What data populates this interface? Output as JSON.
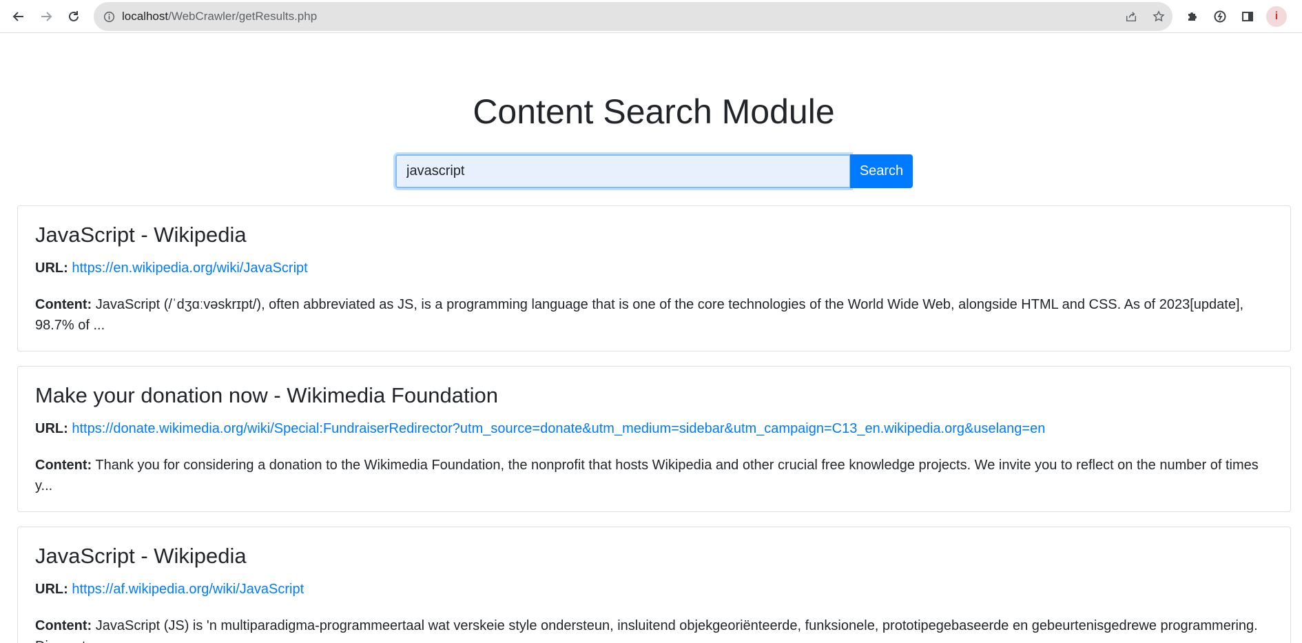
{
  "browser": {
    "url_host": "localhost",
    "url_path": "/WebCrawler/getResults.php",
    "avatar_letter": "i"
  },
  "page": {
    "title": "Content Search Module",
    "search": {
      "value": "javascript",
      "button_label": "Search"
    },
    "url_label": "URL:",
    "content_label": "Content:",
    "results": [
      {
        "title": "JavaScript - Wikipedia",
        "url": "https://en.wikipedia.org/wiki/JavaScript",
        "content": "JavaScript (/ˈdʒɑːvəskrɪpt/), often abbreviated as JS, is a programming language that is one of the core technologies of the World Wide Web, alongside HTML and CSS. As of 2023[update], 98.7% of ..."
      },
      {
        "title": "Make your donation now - Wikimedia Foundation",
        "url": "https://donate.wikimedia.org/wiki/Special:FundraiserRedirector?utm_source=donate&utm_medium=sidebar&utm_campaign=C13_en.wikipedia.org&uselang=en",
        "content": "Thank you for considering a donation to the Wikimedia Foundation, the nonprofit that hosts Wikipedia and other crucial free knowledge projects. We invite you to reflect on the number of times y..."
      },
      {
        "title": "JavaScript - Wikipedia",
        "url": "https://af.wikipedia.org/wiki/JavaScript",
        "content": "JavaScript (JS) is 'n multiparadigma-programmeertaal wat verskeie style ondersteun, insluitend objekgeoriënteerde, funksionele, prototipegebaseerde en gebeurtenisgedrewe programmering. Die sagteware..."
      }
    ]
  },
  "colors": {
    "accent": "#007bff",
    "text": "#212529"
  }
}
